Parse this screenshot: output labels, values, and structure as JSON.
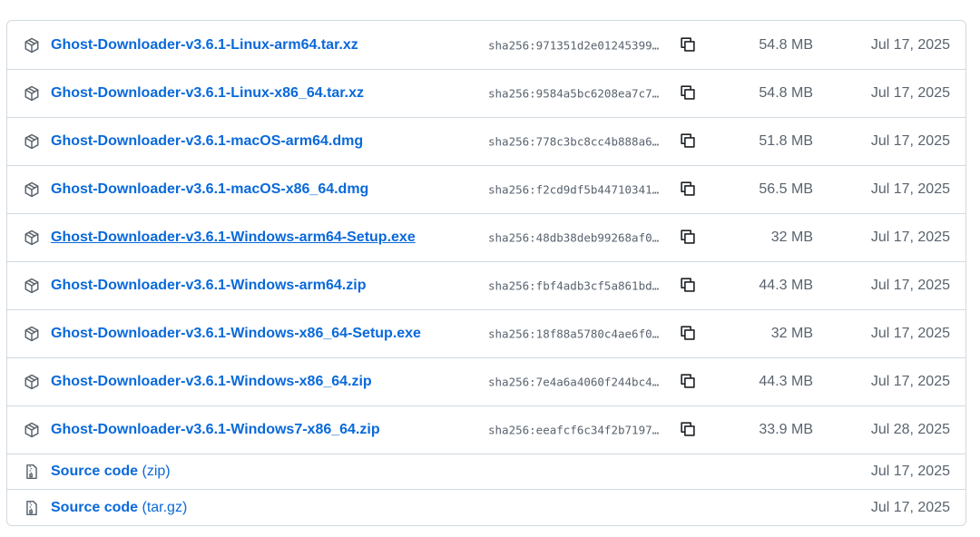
{
  "assets": [
    {
      "name": "Ghost-Downloader-v3.6.1-Linux-arm64.tar.xz",
      "sha": "sha256:971351d2e01245399…",
      "size": "54.8 MB",
      "date": "Jul 17, 2025"
    },
    {
      "name": "Ghost-Downloader-v3.6.1-Linux-x86_64.tar.xz",
      "sha": "sha256:9584a5bc6208ea7c7…",
      "size": "54.8 MB",
      "date": "Jul 17, 2025"
    },
    {
      "name": "Ghost-Downloader-v3.6.1-macOS-arm64.dmg",
      "sha": "sha256:778c3bc8cc4b888a6…",
      "size": "51.8 MB",
      "date": "Jul 17, 2025"
    },
    {
      "name": "Ghost-Downloader-v3.6.1-macOS-x86_64.dmg",
      "sha": "sha256:f2cd9df5b44710341…",
      "size": "56.5 MB",
      "date": "Jul 17, 2025"
    },
    {
      "name": "Ghost-Downloader-v3.6.1-Windows-arm64-Setup.exe",
      "sha": "sha256:48db38deb99268af0…",
      "size": "32 MB",
      "date": "Jul 17, 2025"
    },
    {
      "name": "Ghost-Downloader-v3.6.1-Windows-arm64.zip",
      "sha": "sha256:fbf4adb3cf5a861bd…",
      "size": "44.3 MB",
      "date": "Jul 17, 2025"
    },
    {
      "name": "Ghost-Downloader-v3.6.1-Windows-x86_64-Setup.exe",
      "sha": "sha256:18f88a5780c4ae6f0…",
      "size": "32 MB",
      "date": "Jul 17, 2025"
    },
    {
      "name": "Ghost-Downloader-v3.6.1-Windows-x86_64.zip",
      "sha": "sha256:7e4a6a4060f244bc4…",
      "size": "44.3 MB",
      "date": "Jul 17, 2025"
    },
    {
      "name": "Ghost-Downloader-v3.6.1-Windows7-x86_64.zip",
      "sha": "sha256:eeafcf6c34f2b7197…",
      "size": "33.9 MB",
      "date": "Jul 28, 2025"
    }
  ],
  "source_code": [
    {
      "label": "Source code",
      "suffix": "(zip)",
      "date": "Jul 17, 2025"
    },
    {
      "label": "Source code",
      "suffix": "(tar.gz)",
      "date": "Jul 17, 2025"
    }
  ],
  "icons": {
    "asset": "package-icon",
    "source": "file-zip-icon",
    "copy": "copy-icon"
  },
  "colors": {
    "link": "#0969da",
    "muted": "#59636e",
    "border": "#d1d9e0"
  }
}
